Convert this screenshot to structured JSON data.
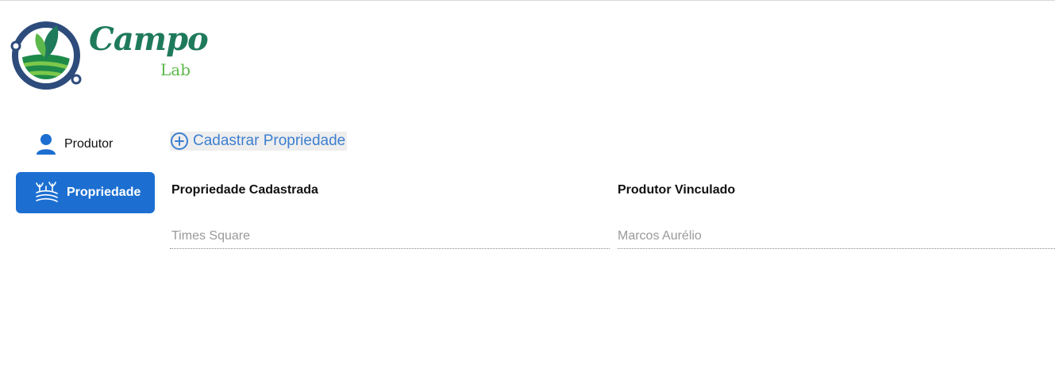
{
  "brand": {
    "name": "Campo",
    "sub": "Lab",
    "colors": {
      "primary": "#1e7a5a",
      "accent": "#5cb84a",
      "ring": "#2d4c7c"
    }
  },
  "sidebar": {
    "items": [
      {
        "label": "Produtor",
        "icon": "user-icon",
        "active": false
      },
      {
        "label": "Propriedade",
        "icon": "farm-field-icon",
        "active": true
      }
    ],
    "active_color": "#1c6fd1"
  },
  "main": {
    "add_button": {
      "label": "Cadastrar Propriedade",
      "icon": "plus-circle-icon"
    },
    "table": {
      "columns": [
        "Propriedade Cadastrada",
        "Produtor Vinculado"
      ],
      "rows": [
        [
          "Times Square",
          "Marcos Aurélio"
        ]
      ]
    }
  }
}
